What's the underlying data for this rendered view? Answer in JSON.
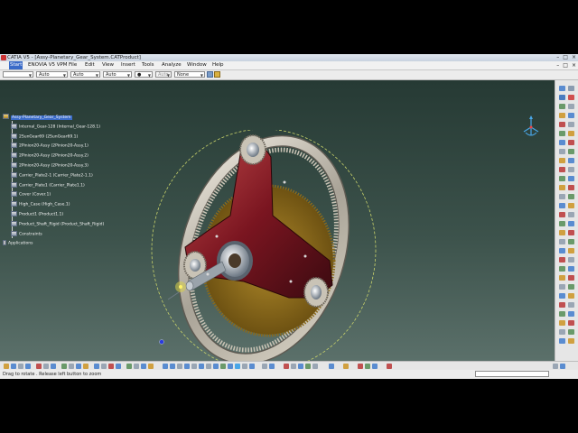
{
  "window": {
    "title": "CATIA V5 - [Assy-Planetary_Gear_System.CATProduct]",
    "controls": [
      "–",
      "□",
      "×"
    ]
  },
  "menu": {
    "items": [
      "Start",
      "ENOVIA V5 VPM",
      "File",
      "Edit",
      "View",
      "Insert",
      "Tools",
      "Analyze",
      "Window",
      "Help"
    ],
    "active": "Start",
    "mdi_controls": [
      "–",
      "□",
      "×"
    ]
  },
  "properties": {
    "fill_color": "",
    "transparency": "Auto",
    "line_thickness": "Auto",
    "line_type": "Auto",
    "point_type": "●",
    "layer_auto": "Auto",
    "layer": "None"
  },
  "tree": {
    "root": "Assy-Planetary_Gear_System",
    "children": [
      "Internal_Gear-128 (Internal_Gear-128.1)",
      "2SunGear69 (2SunGear69.1)",
      "2Pinion20-Assy (2Pinion20-Assy.1)",
      "2Pinion20-Assy (2Pinion20-Assy.2)",
      "2Pinion20-Assy (2Pinion20-Assy.3)",
      "Carrier_Plate2-1 (Carrier_Plate2-1.1)",
      "Carrier_Plate1 (Carrier_Plate1.1)",
      "Cover (Cover.1)",
      "High_Case (High_Case.1)",
      "Product1 (Product1.1)",
      "Product_Shaft_Rigid (Product_Shaft_Rigid)",
      "Constraints"
    ],
    "applications": "Applications"
  },
  "status": {
    "message": "Drag to rotate . Release left button to zoom"
  },
  "colors": {
    "selection": "#3a6bc8",
    "viewport_top": "#263a34",
    "viewport_bottom": "#5b706a",
    "ring_gear": "#c9c3b6",
    "sun_gear": "#8a6a1c",
    "carrier": "#7a1520"
  }
}
